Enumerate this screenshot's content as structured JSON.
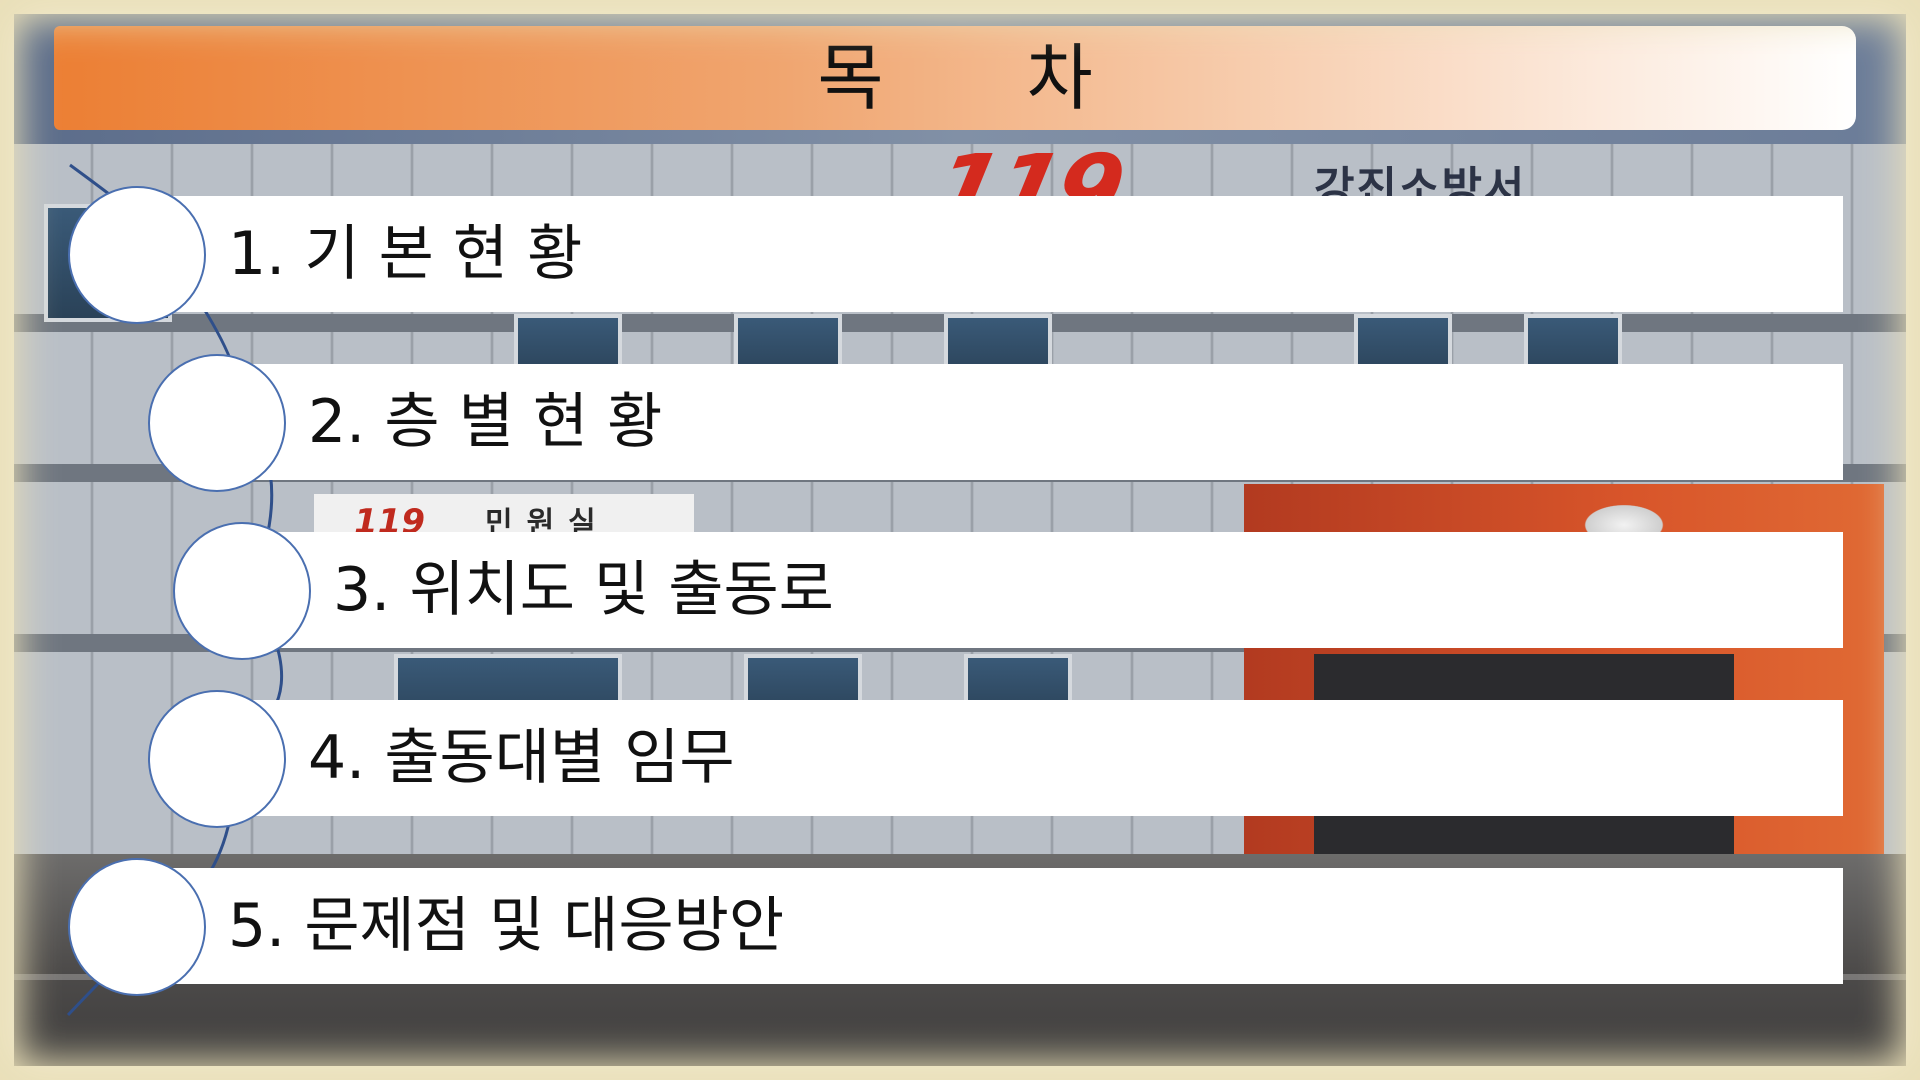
{
  "slide": {
    "title": "목 차",
    "items": [
      {
        "label": "1. 기 본 현 황"
      },
      {
        "label": "2. 층 별 현 황"
      },
      {
        "label": "3. 위치도 및 출동로"
      },
      {
        "label": "4. 출동대별 임무"
      },
      {
        "label": "5. 문제점 및 대응방안"
      }
    ]
  },
  "background": {
    "logo_text": "119",
    "building_name": "강진소방서",
    "sign_number": "119",
    "sign_text": "민원실"
  },
  "colors": {
    "title_gradient_start": "#ec7f34",
    "title_gradient_end": "#ffffff",
    "item_bar": "#ffffff",
    "circle_border": "#4a6fb0",
    "accent_red": "#d42a1e"
  }
}
